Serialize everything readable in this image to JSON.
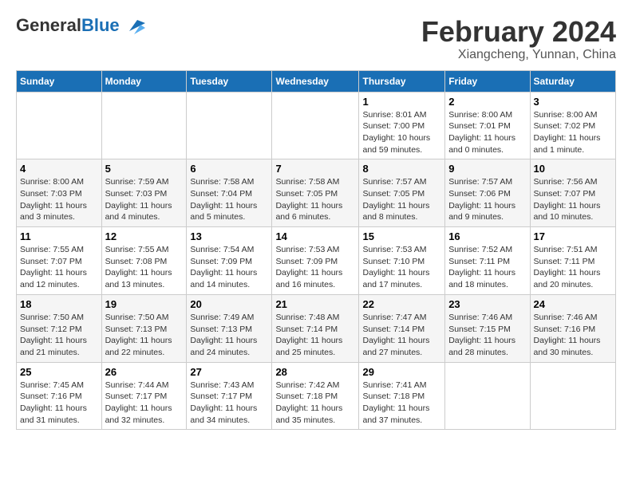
{
  "header": {
    "logo_general": "General",
    "logo_blue": "Blue",
    "main_title": "February 2024",
    "subtitle": "Xiangcheng, Yunnan, China"
  },
  "calendar": {
    "days_of_week": [
      "Sunday",
      "Monday",
      "Tuesday",
      "Wednesday",
      "Thursday",
      "Friday",
      "Saturday"
    ],
    "weeks": [
      [
        {
          "day": "",
          "info": ""
        },
        {
          "day": "",
          "info": ""
        },
        {
          "day": "",
          "info": ""
        },
        {
          "day": "",
          "info": ""
        },
        {
          "day": "1",
          "info": "Sunrise: 8:01 AM\nSunset: 7:00 PM\nDaylight: 10 hours and 59 minutes."
        },
        {
          "day": "2",
          "info": "Sunrise: 8:00 AM\nSunset: 7:01 PM\nDaylight: 11 hours and 0 minutes."
        },
        {
          "day": "3",
          "info": "Sunrise: 8:00 AM\nSunset: 7:02 PM\nDaylight: 11 hours and 1 minute."
        }
      ],
      [
        {
          "day": "4",
          "info": "Sunrise: 8:00 AM\nSunset: 7:03 PM\nDaylight: 11 hours and 3 minutes."
        },
        {
          "day": "5",
          "info": "Sunrise: 7:59 AM\nSunset: 7:03 PM\nDaylight: 11 hours and 4 minutes."
        },
        {
          "day": "6",
          "info": "Sunrise: 7:58 AM\nSunset: 7:04 PM\nDaylight: 11 hours and 5 minutes."
        },
        {
          "day": "7",
          "info": "Sunrise: 7:58 AM\nSunset: 7:05 PM\nDaylight: 11 hours and 6 minutes."
        },
        {
          "day": "8",
          "info": "Sunrise: 7:57 AM\nSunset: 7:05 PM\nDaylight: 11 hours and 8 minutes."
        },
        {
          "day": "9",
          "info": "Sunrise: 7:57 AM\nSunset: 7:06 PM\nDaylight: 11 hours and 9 minutes."
        },
        {
          "day": "10",
          "info": "Sunrise: 7:56 AM\nSunset: 7:07 PM\nDaylight: 11 hours and 10 minutes."
        }
      ],
      [
        {
          "day": "11",
          "info": "Sunrise: 7:55 AM\nSunset: 7:07 PM\nDaylight: 11 hours and 12 minutes."
        },
        {
          "day": "12",
          "info": "Sunrise: 7:55 AM\nSunset: 7:08 PM\nDaylight: 11 hours and 13 minutes."
        },
        {
          "day": "13",
          "info": "Sunrise: 7:54 AM\nSunset: 7:09 PM\nDaylight: 11 hours and 14 minutes."
        },
        {
          "day": "14",
          "info": "Sunrise: 7:53 AM\nSunset: 7:09 PM\nDaylight: 11 hours and 16 minutes."
        },
        {
          "day": "15",
          "info": "Sunrise: 7:53 AM\nSunset: 7:10 PM\nDaylight: 11 hours and 17 minutes."
        },
        {
          "day": "16",
          "info": "Sunrise: 7:52 AM\nSunset: 7:11 PM\nDaylight: 11 hours and 18 minutes."
        },
        {
          "day": "17",
          "info": "Sunrise: 7:51 AM\nSunset: 7:11 PM\nDaylight: 11 hours and 20 minutes."
        }
      ],
      [
        {
          "day": "18",
          "info": "Sunrise: 7:50 AM\nSunset: 7:12 PM\nDaylight: 11 hours and 21 minutes."
        },
        {
          "day": "19",
          "info": "Sunrise: 7:50 AM\nSunset: 7:13 PM\nDaylight: 11 hours and 22 minutes."
        },
        {
          "day": "20",
          "info": "Sunrise: 7:49 AM\nSunset: 7:13 PM\nDaylight: 11 hours and 24 minutes."
        },
        {
          "day": "21",
          "info": "Sunrise: 7:48 AM\nSunset: 7:14 PM\nDaylight: 11 hours and 25 minutes."
        },
        {
          "day": "22",
          "info": "Sunrise: 7:47 AM\nSunset: 7:14 PM\nDaylight: 11 hours and 27 minutes."
        },
        {
          "day": "23",
          "info": "Sunrise: 7:46 AM\nSunset: 7:15 PM\nDaylight: 11 hours and 28 minutes."
        },
        {
          "day": "24",
          "info": "Sunrise: 7:46 AM\nSunset: 7:16 PM\nDaylight: 11 hours and 30 minutes."
        }
      ],
      [
        {
          "day": "25",
          "info": "Sunrise: 7:45 AM\nSunset: 7:16 PM\nDaylight: 11 hours and 31 minutes."
        },
        {
          "day": "26",
          "info": "Sunrise: 7:44 AM\nSunset: 7:17 PM\nDaylight: 11 hours and 32 minutes."
        },
        {
          "day": "27",
          "info": "Sunrise: 7:43 AM\nSunset: 7:17 PM\nDaylight: 11 hours and 34 minutes."
        },
        {
          "day": "28",
          "info": "Sunrise: 7:42 AM\nSunset: 7:18 PM\nDaylight: 11 hours and 35 minutes."
        },
        {
          "day": "29",
          "info": "Sunrise: 7:41 AM\nSunset: 7:18 PM\nDaylight: 11 hours and 37 minutes."
        },
        {
          "day": "",
          "info": ""
        },
        {
          "day": "",
          "info": ""
        }
      ]
    ]
  }
}
